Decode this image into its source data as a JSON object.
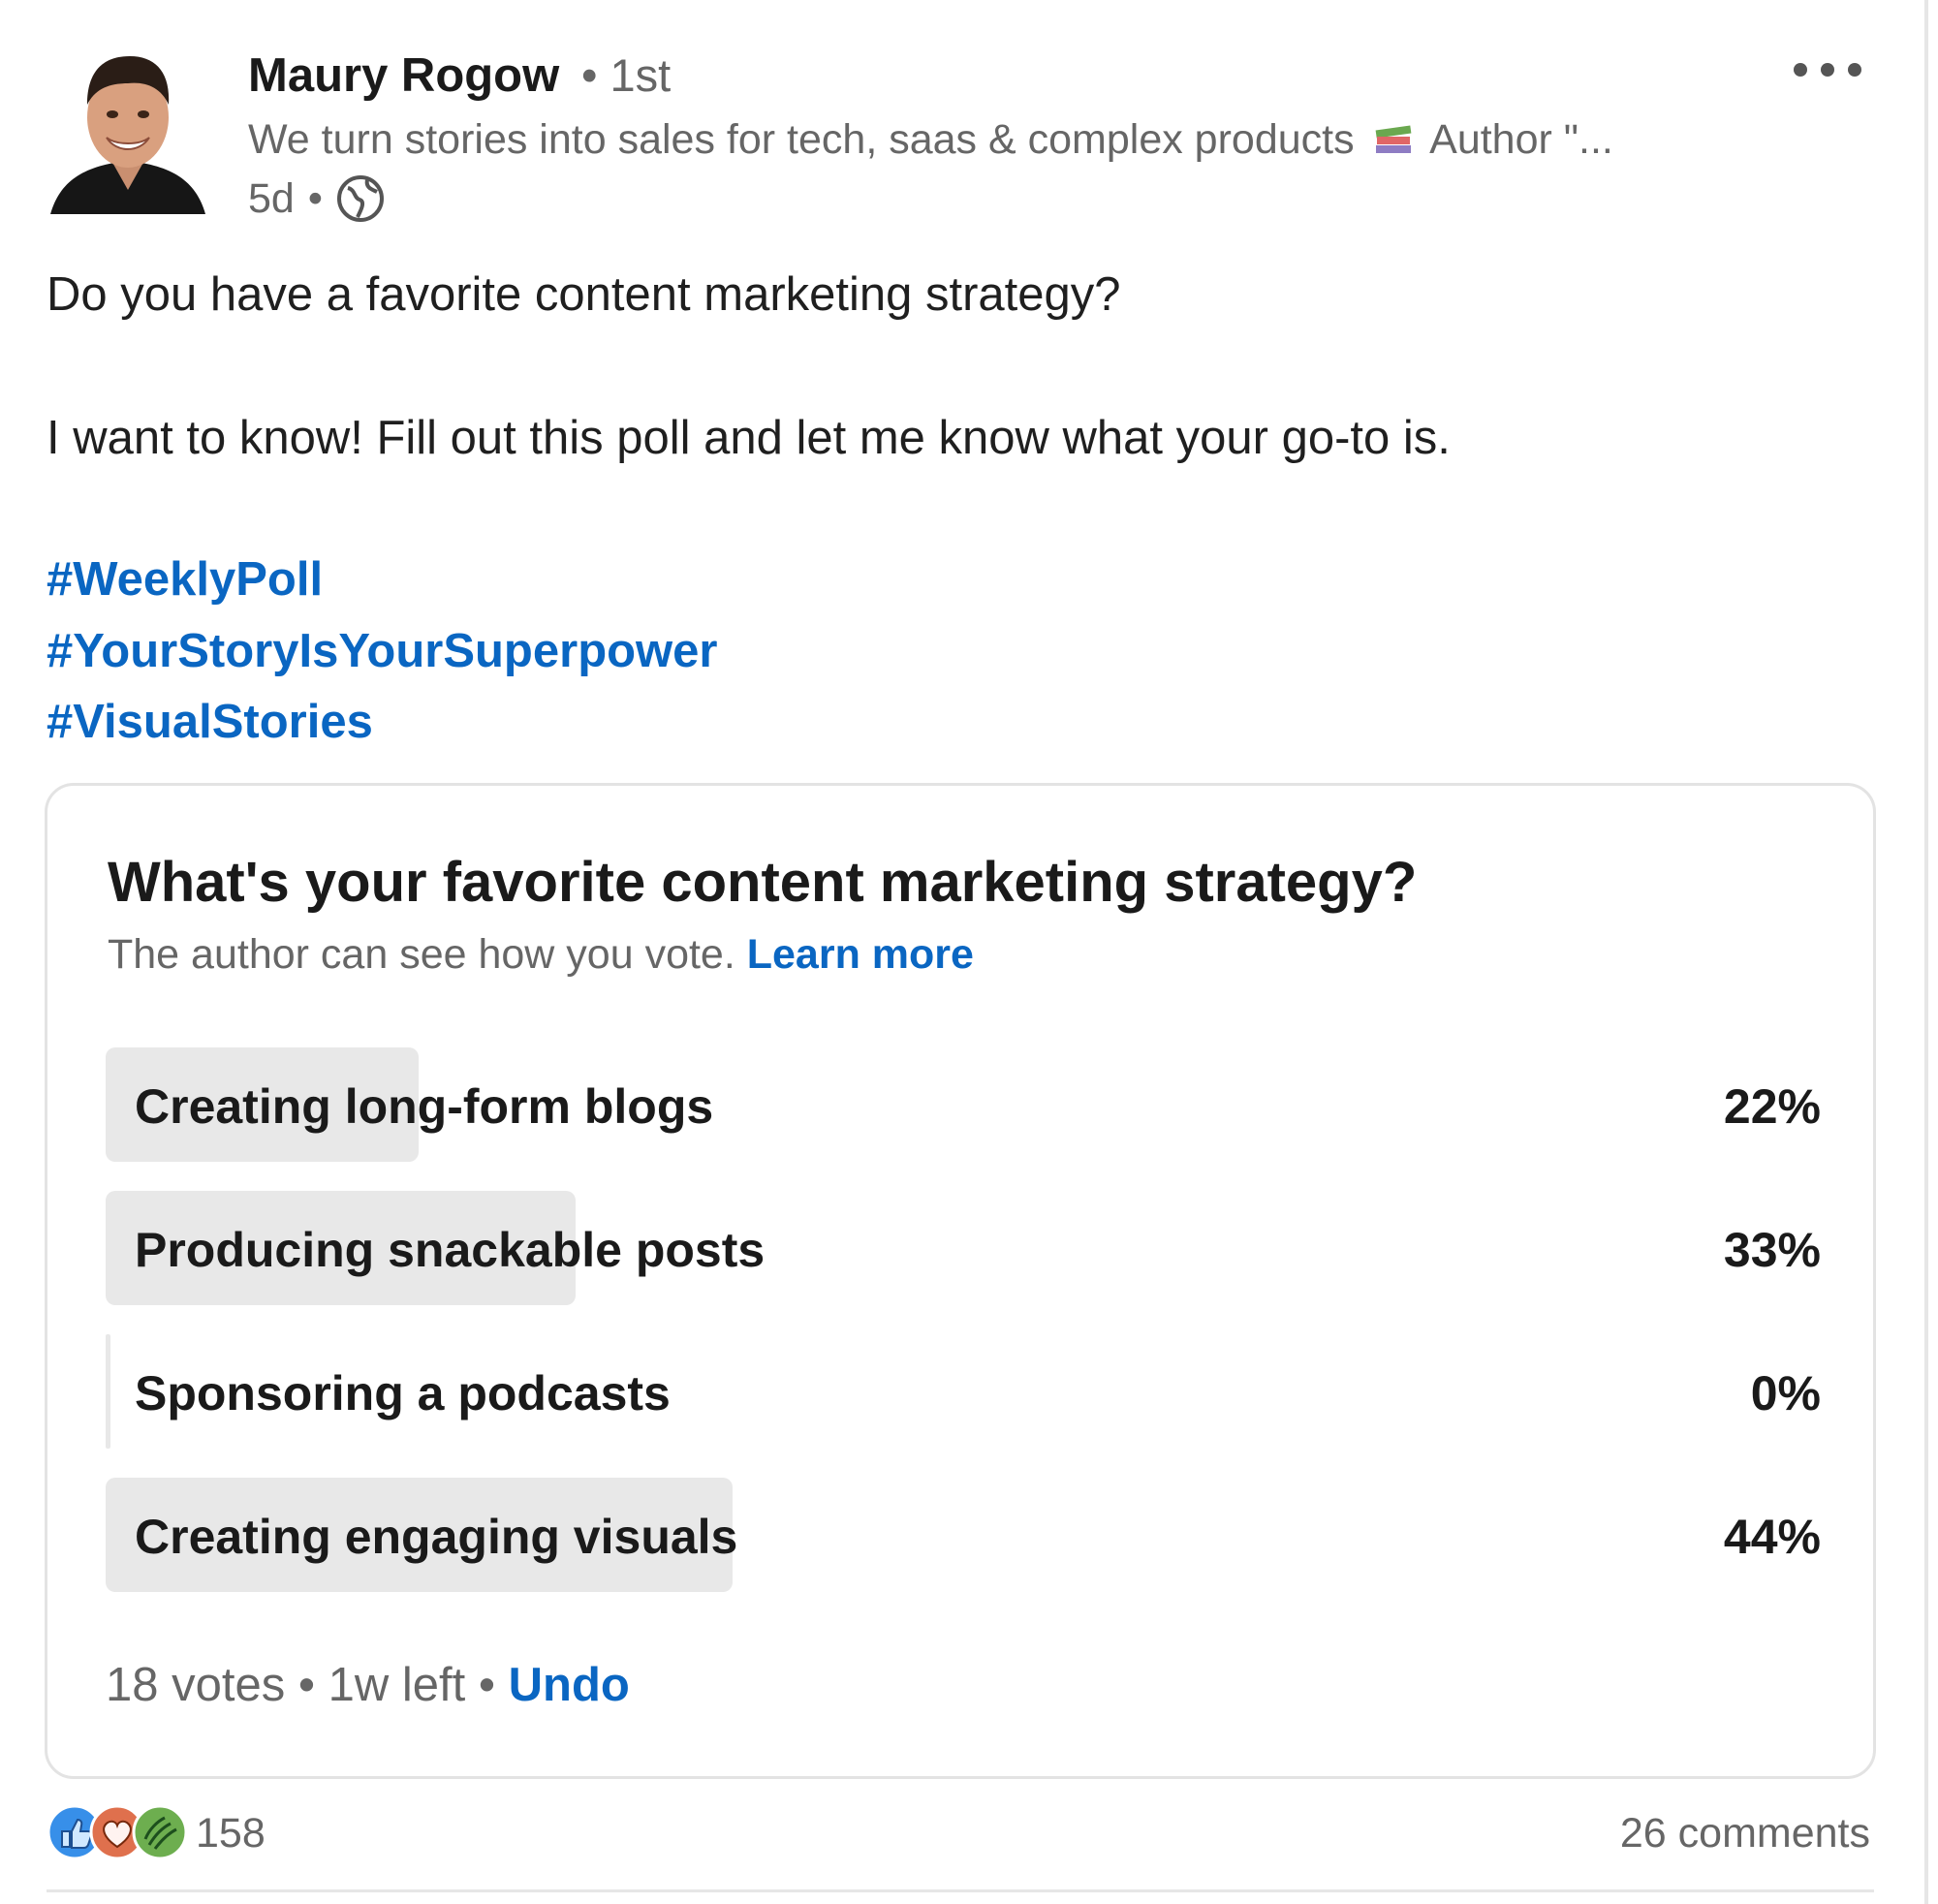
{
  "author": {
    "name": "Maury Rogow",
    "degree": "1st",
    "headline_prefix": "We turn stories into sales for tech, saas & complex products",
    "headline_suffix": "Author \"...",
    "time": "5d"
  },
  "post": {
    "line1": "Do you have a favorite content marketing strategy?",
    "line2": "I want to know! Fill out this poll and let me know what your go-to is.",
    "hashtags": [
      "#WeeklyPoll",
      "#YourStoryIsYourSuperpower",
      "#VisualStories"
    ]
  },
  "poll": {
    "question": "What's your favorite content marketing strategy?",
    "note": "The author can see how you vote.",
    "learn_more": "Learn more",
    "options": [
      {
        "label": "Creating long-form blogs",
        "percent_text": "22%",
        "percent": 22
      },
      {
        "label": "Producing snackable posts",
        "percent_text": "33%",
        "percent": 33
      },
      {
        "label": "Sponsoring a podcasts",
        "percent_text": "0%",
        "percent": 0
      },
      {
        "label": "Creating engaging visuals",
        "percent_text": "44%",
        "percent": 44
      }
    ],
    "votes": "18 votes",
    "time_left": "1w left",
    "undo": "Undo"
  },
  "social": {
    "reaction_count": "158",
    "comments": "26 comments",
    "reaction_icons": [
      "like-icon",
      "love-icon",
      "support-icon"
    ]
  },
  "colors": {
    "link": "#0a66c2",
    "bar": "#e8e8e8",
    "muted_text": "#666666"
  }
}
